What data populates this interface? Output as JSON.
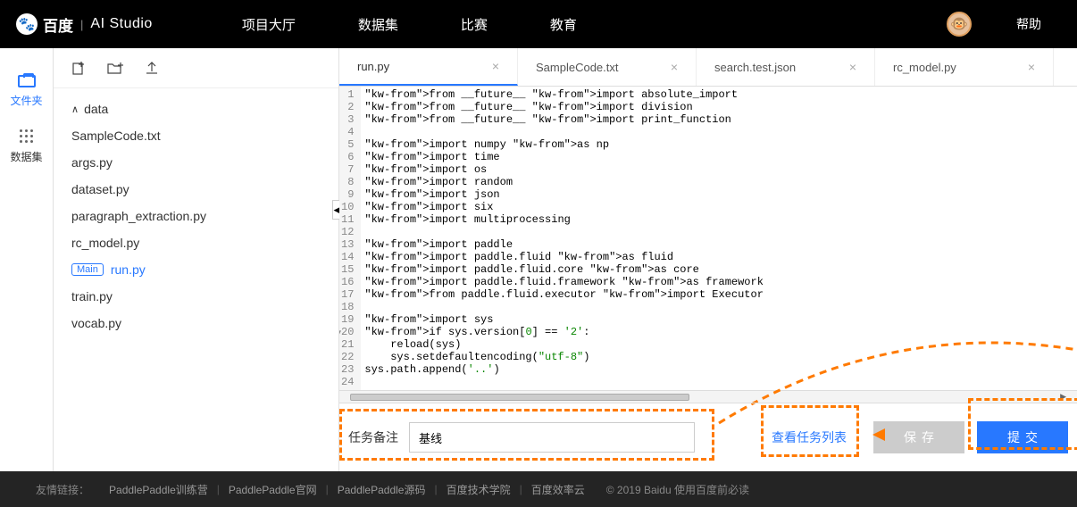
{
  "header": {
    "brand_cn": "百度",
    "brand_sub": "AI Studio",
    "nav": [
      "项目大厅",
      "数据集",
      "比赛",
      "教育"
    ],
    "help": "帮助"
  },
  "sidebar": {
    "tabs": [
      {
        "label": "文件夹",
        "active": true
      },
      {
        "label": "数据集",
        "active": false
      }
    ]
  },
  "file_toolbar_icons": [
    "new-file-icon",
    "new-folder-icon",
    "upload-icon"
  ],
  "file_tree": {
    "folder": "data",
    "files": [
      {
        "name": "SampleCode.txt"
      },
      {
        "name": "args.py"
      },
      {
        "name": "dataset.py"
      },
      {
        "name": "paragraph_extraction.py"
      },
      {
        "name": "rc_model.py"
      },
      {
        "name": "run.py",
        "main": true,
        "active": true
      },
      {
        "name": "train.py"
      },
      {
        "name": "vocab.py"
      }
    ]
  },
  "editor_tabs": [
    {
      "label": "run.py",
      "active": true
    },
    {
      "label": "SampleCode.txt",
      "active": false
    },
    {
      "label": "search.test.json",
      "active": false
    },
    {
      "label": "rc_model.py",
      "active": false
    }
  ],
  "code_lines": [
    "from __future__ import absolute_import",
    "from __future__ import division",
    "from __future__ import print_function",
    "",
    "import numpy as np",
    "import time",
    "import os",
    "import random",
    "import json",
    "import six",
    "import multiprocessing",
    "",
    "import paddle",
    "import paddle.fluid as fluid",
    "import paddle.fluid.core as core",
    "import paddle.fluid.framework as framework",
    "from paddle.fluid.executor import Executor",
    "",
    "import sys",
    "if sys.version[0] == '2':",
    "    reload(sys)",
    "    sys.setdefaultencoding(\"utf-8\")",
    "sys.path.append('..')",
    ""
  ],
  "bottom": {
    "task_label": "任务备注",
    "task_value": "基线",
    "view_queue": "查看任务列表",
    "save": "保存",
    "submit": "提交"
  },
  "footer": {
    "label": "友情链接：",
    "links": [
      "PaddlePaddle训练营",
      "PaddlePaddle官网",
      "PaddlePaddle源码",
      "百度技术学院",
      "百度效率云"
    ],
    "copyright": "© 2019 Baidu 使用百度前必读"
  }
}
